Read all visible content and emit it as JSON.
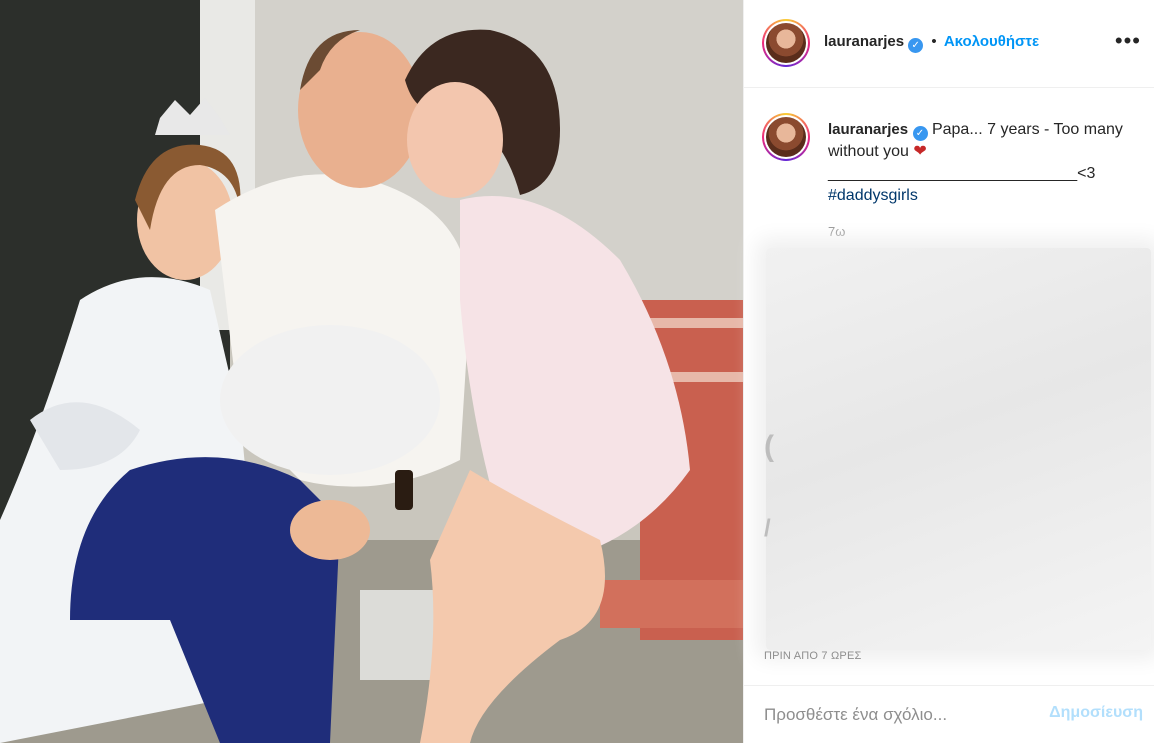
{
  "post": {
    "username": "lauranarjes",
    "verified_icon": "verified-badge-icon",
    "follow_label": "Ακολουθήστε",
    "separator": "•",
    "more_label": "•••"
  },
  "caption": {
    "username": "lauranarjes",
    "text_main": "Papa... 7 years - Too many without you",
    "heart": "❤",
    "underline": "____________________________",
    "underline_suffix": "<3",
    "hashtag": "#daddysgirls",
    "age": "7ω"
  },
  "timestamp": "ΠΡΙΝ ΑΠΟ 7 ΩΡΕΣ",
  "comment": {
    "placeholder": "Προσθέστε ένα σχόλιο...",
    "post_label": "Δημοσίευση"
  },
  "colors": {
    "accent": "#0095f6",
    "post_disabled": "#b2dffc",
    "muted": "#8e8e8e"
  }
}
